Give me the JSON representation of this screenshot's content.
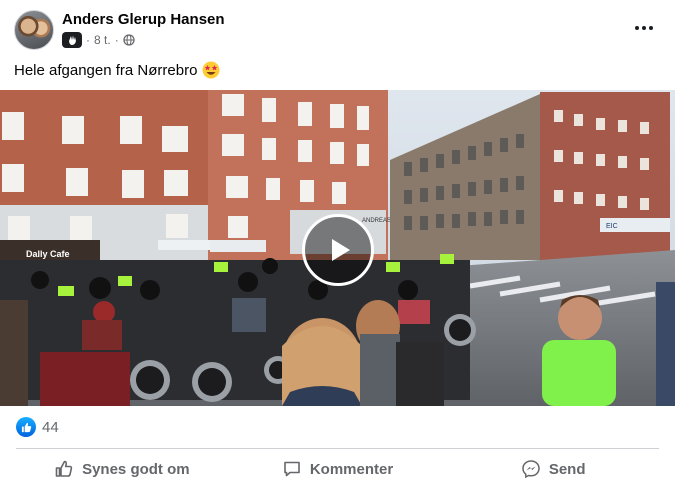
{
  "post": {
    "author": "Anders Glerup Hansen",
    "time": "8 t.",
    "separator": "·",
    "caption": "Hele afgangen fra Nørrebro",
    "caption_emoji": "star-struck-emoji",
    "media": {
      "type": "video",
      "storefront_signs": [
        "Dally Cafe",
        "ANDREAS",
        "EIC"
      ]
    }
  },
  "reactions": {
    "icon": "like-icon",
    "count": "44"
  },
  "actions": {
    "like": "Synes godt om",
    "comment": "Kommenter",
    "share": "Send"
  },
  "colors": {
    "accent": "#1877f2",
    "text_secondary": "#65676b",
    "divider": "#ced0d4"
  }
}
